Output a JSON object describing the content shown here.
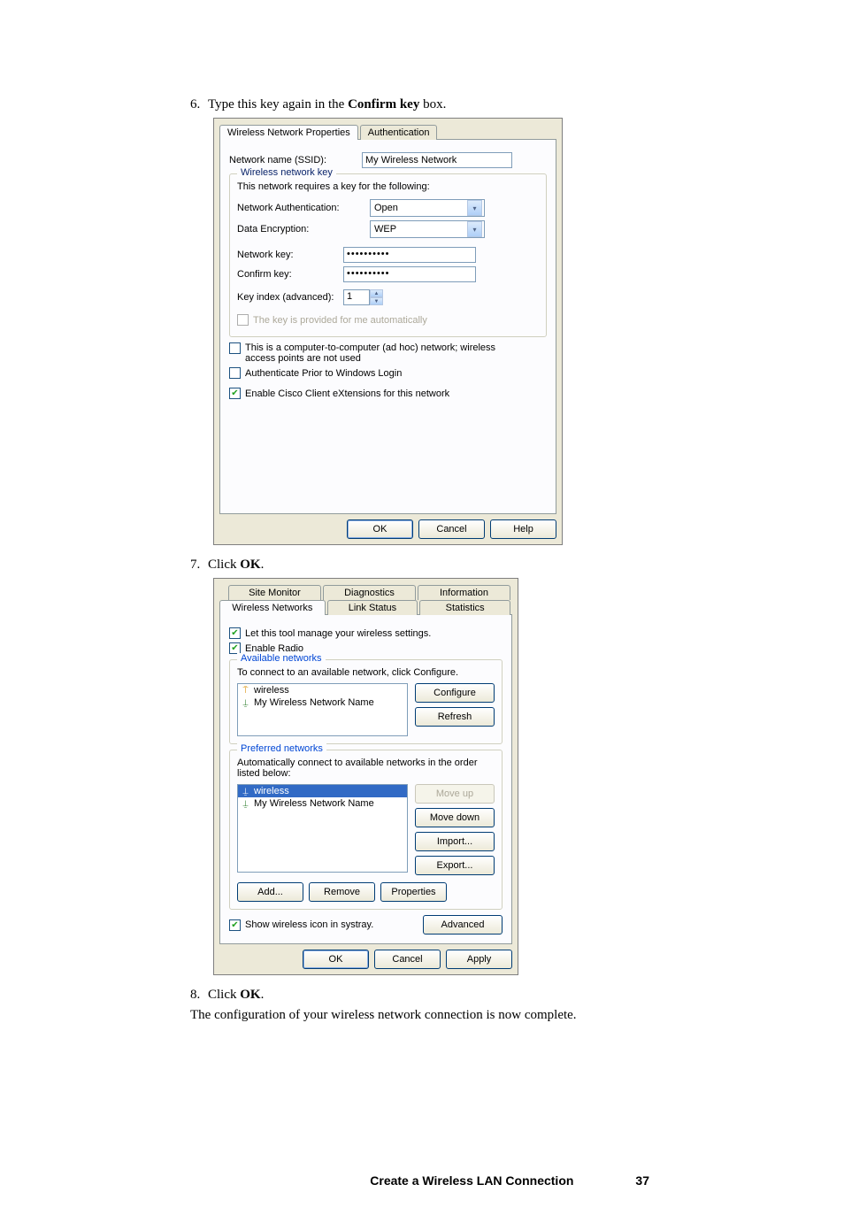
{
  "steps": {
    "s6": {
      "num": "6.",
      "pre": "Type this key again in the ",
      "bold": "Confirm key",
      "post": " box."
    },
    "s7": {
      "num": "7.",
      "pre": "Click ",
      "bold": "OK",
      "post": "."
    },
    "s8": {
      "num": "8.",
      "pre": "Click ",
      "bold": "OK",
      "post": "."
    }
  },
  "closing": "The configuration of your wireless network connection is now complete.",
  "footer": {
    "title": "Create a Wireless LAN Connection",
    "page": "37"
  },
  "dlg1": {
    "tabs": {
      "props": "Wireless Network Properties",
      "auth": "Authentication"
    },
    "ssid_label": "Network name (SSID):",
    "ssid_value": "My Wireless Network",
    "group_title": "Wireless network key",
    "requires": "This network requires a key for the following:",
    "auth_label": "Network Authentication:",
    "auth_value": "Open",
    "enc_label": "Data Encryption:",
    "enc_value": "WEP",
    "netkey_label": "Network key:",
    "netkey_value": "••••••••••",
    "confkey_label": "Confirm key:",
    "confkey_value": "••••••••••",
    "keyidx_label": "Key index (advanced):",
    "keyidx_value": "1",
    "auto_key": "The key is provided for me automatically",
    "adhoc": "This is a computer-to-computer (ad hoc) network; wireless access points are not used",
    "auth_prior": "Authenticate Prior to Windows Login",
    "cisco": "Enable Cisco Client eXtensions for this network",
    "ok": "OK",
    "cancel": "Cancel",
    "help": "Help"
  },
  "dlg2": {
    "tabs": {
      "site": "Site Monitor",
      "diag": "Diagnostics",
      "info": "Information",
      "wn": "Wireless Networks",
      "ls": "Link Status",
      "stat": "Statistics"
    },
    "let_tool": "Let this tool manage your wireless settings.",
    "enable_radio": "Enable Radio",
    "avail_title": "Available networks",
    "avail_desc": "To connect to an available network, click Configure.",
    "net_wireless": "wireless",
    "net_my": "My Wireless Network Name",
    "configure": "Configure",
    "refresh": "Refresh",
    "pref_title": "Preferred networks",
    "pref_desc": "Automatically connect to available networks in the order listed below:",
    "moveup": "Move up",
    "movedown": "Move down",
    "import": "Import...",
    "export": "Export...",
    "add": "Add...",
    "remove": "Remove",
    "properties": "Properties",
    "systray": "Show wireless icon in systray.",
    "advanced": "Advanced",
    "ok": "OK",
    "cancel": "Cancel",
    "apply": "Apply"
  }
}
